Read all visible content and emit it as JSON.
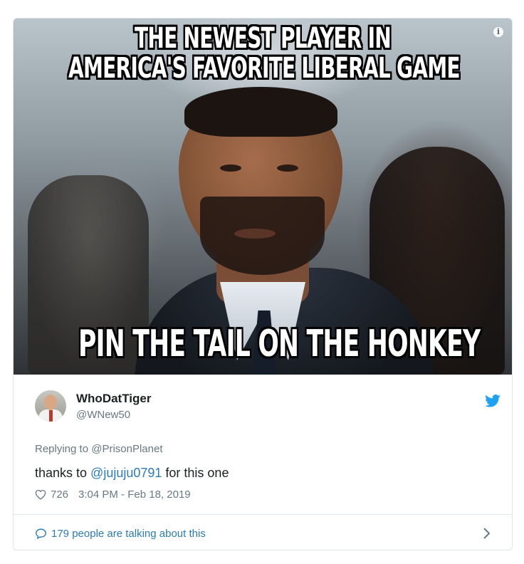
{
  "meme": {
    "top_line_1": "THE NEWEST PLAYER IN",
    "top_line_2": "AMERICA'S FAVORITE LIBERAL GAME",
    "bottom_line": "PIN THE TAIL ON THE HONKEY",
    "info_icon": "i"
  },
  "author": {
    "display_name": "WhoDatTiger",
    "handle": "@WNew50",
    "avatar_icon": "avatar"
  },
  "tweet": {
    "reply_prefix": "Replying to",
    "reply_to": "@PrisonPlanet",
    "text_before": "thanks to ",
    "mention": "@jujuju0791",
    "text_after": " for this one",
    "like_count": "726",
    "timestamp": "3:04 PM - Feb 18, 2019"
  },
  "footer": {
    "talking_label": "179 people are talking about this"
  },
  "colors": {
    "link": "#2b7bb9",
    "twitter_blue": "#1da1f2",
    "muted": "#697882",
    "text": "#1c2022"
  },
  "icons": [
    "info-icon",
    "twitter-bird-icon",
    "heart-icon",
    "speech-bubble-icon",
    "chevron-right-icon"
  ]
}
